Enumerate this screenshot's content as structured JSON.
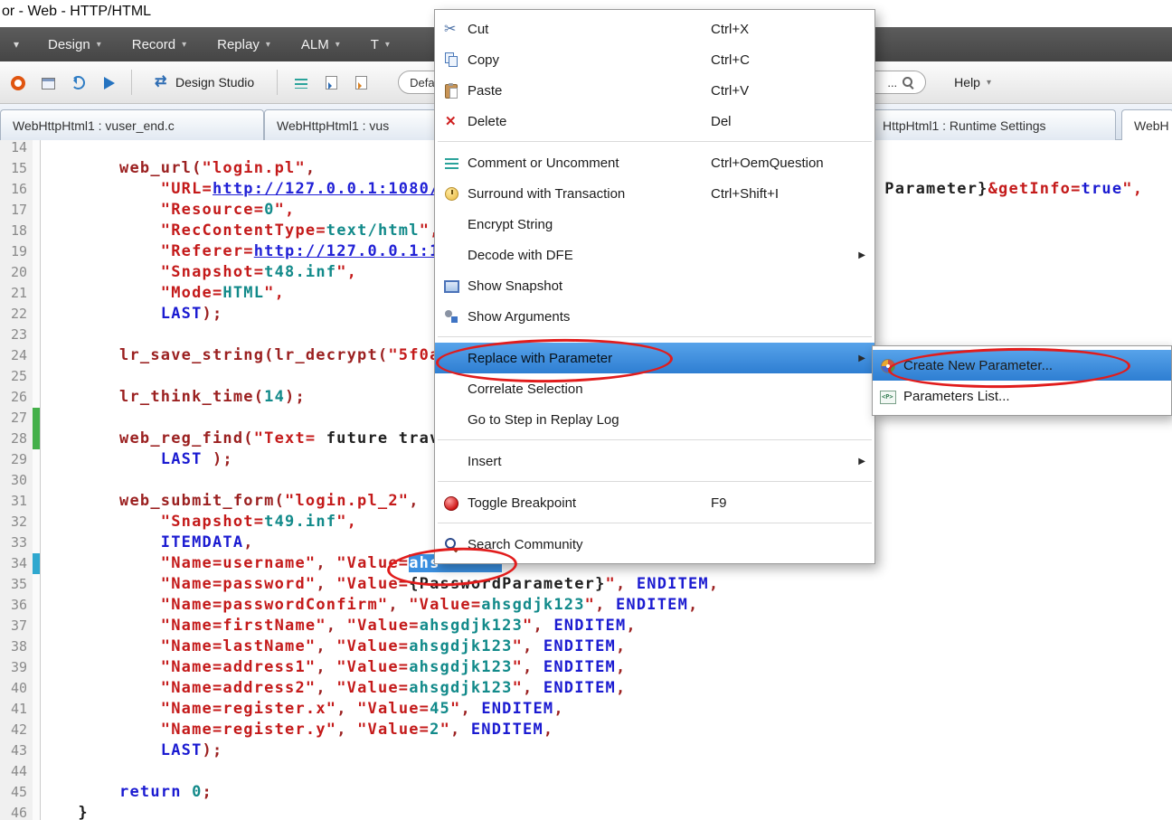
{
  "window": {
    "title": "or - Web - HTTP/HTML"
  },
  "icons": {
    "caret_down": "▾",
    "submenu_arrow": "▶"
  },
  "menubar": {
    "items": [
      {
        "label": "Design"
      },
      {
        "label": "Record"
      },
      {
        "label": "Replay"
      },
      {
        "label": "ALM"
      },
      {
        "label": "T"
      }
    ]
  },
  "toolbar": {
    "design_studio_label": "Design Studio",
    "profile_value": "Defaul",
    "search_text": "...",
    "help_label": "Help"
  },
  "tabs": [
    {
      "label": "WebHttpHtml1 : vuser_end.c",
      "active": false
    },
    {
      "label": "WebHttpHtml1 : vus",
      "active": false
    },
    {
      "label": "HttpHtml1 : Runtime Settings",
      "active": false
    },
    {
      "label": "WebH",
      "active": true
    }
  ],
  "context_menu": {
    "items": [
      {
        "type": "item",
        "icon": "cut-icon",
        "label": "Cut",
        "shortcut": "Ctrl+X"
      },
      {
        "type": "item",
        "icon": "copy-icon",
        "label": "Copy",
        "shortcut": "Ctrl+C"
      },
      {
        "type": "item",
        "icon": "paste-icon",
        "label": "Paste",
        "shortcut": "Ctrl+V"
      },
      {
        "type": "item",
        "icon": "delete-icon",
        "label": "Delete",
        "shortcut": "Del"
      },
      {
        "type": "separator"
      },
      {
        "type": "item",
        "icon": "comment-icon",
        "label": "Comment or Uncomment",
        "shortcut": "Ctrl+OemQuestion"
      },
      {
        "type": "item",
        "icon": "transaction-icon",
        "label": "Surround with Transaction",
        "shortcut": "Ctrl+Shift+I"
      },
      {
        "type": "item",
        "label": "Encrypt String"
      },
      {
        "type": "item",
        "label": "Decode with DFE",
        "submenu": true
      },
      {
        "type": "item",
        "icon": "snapshot-icon",
        "label": "Show Snapshot"
      },
      {
        "type": "item",
        "icon": "arguments-icon",
        "label": "Show Arguments"
      },
      {
        "type": "separator"
      },
      {
        "type": "item",
        "label": "Replace with Parameter",
        "submenu": true,
        "highlighted": true
      },
      {
        "type": "item",
        "label": "Correlate Selection"
      },
      {
        "type": "item",
        "label": "Go to Step in Replay Log"
      },
      {
        "type": "separator"
      },
      {
        "type": "item",
        "label": "Insert",
        "submenu": true
      },
      {
        "type": "separator"
      },
      {
        "type": "item",
        "icon": "breakpoint-icon",
        "label": "Toggle Breakpoint",
        "shortcut": "F9"
      },
      {
        "type": "separator"
      },
      {
        "type": "item",
        "icon": "search-community-icon",
        "label": "Search Community"
      }
    ]
  },
  "submenu": {
    "items": [
      {
        "icon": "new-parameter-icon",
        "label": "Create New Parameter...",
        "highlighted": true
      },
      {
        "icon": "parameters-list-icon",
        "label": "Parameters List..."
      }
    ]
  },
  "editor": {
    "lines": [
      {
        "no": "14",
        "segments": []
      },
      {
        "no": "15",
        "segments": [
          {
            "t": "       ",
            "c": "sp"
          },
          {
            "t": "web_url(",
            "c": "fn"
          },
          {
            "t": "\"login.pl\"",
            "c": "str"
          },
          {
            "t": ",",
            "c": "pun"
          }
        ]
      },
      {
        "no": "16",
        "segments": [
          {
            "t": "           ",
            "c": "sp"
          },
          {
            "t": "\"URL=",
            "c": "str"
          },
          {
            "t": "http://127.0.0.1:1080/",
            "c": "url"
          },
          {
            "t": "                                           ",
            "c": "sp"
          },
          {
            "t": "Parameter}",
            "c": "param"
          },
          {
            "t": "&getInfo=",
            "c": "str"
          },
          {
            "t": "true",
            "c": "kw"
          },
          {
            "t": "\",",
            "c": "str"
          }
        ]
      },
      {
        "no": "17",
        "segments": [
          {
            "t": "           ",
            "c": "sp"
          },
          {
            "t": "\"Resource=",
            "c": "str"
          },
          {
            "t": "0",
            "c": "val"
          },
          {
            "t": "\",",
            "c": "str"
          }
        ]
      },
      {
        "no": "18",
        "segments": [
          {
            "t": "           ",
            "c": "sp"
          },
          {
            "t": "\"RecContentType=",
            "c": "str"
          },
          {
            "t": "text/html",
            "c": "val"
          },
          {
            "t": "\",",
            "c": "str"
          }
        ]
      },
      {
        "no": "19",
        "segments": [
          {
            "t": "           ",
            "c": "sp"
          },
          {
            "t": "\"Referer=",
            "c": "str"
          },
          {
            "t": "http://127.0.0.1:1",
            "c": "url"
          }
        ]
      },
      {
        "no": "20",
        "segments": [
          {
            "t": "           ",
            "c": "sp"
          },
          {
            "t": "\"Snapshot=",
            "c": "str"
          },
          {
            "t": "t48.inf",
            "c": "val"
          },
          {
            "t": "\",",
            "c": "str"
          }
        ]
      },
      {
        "no": "21",
        "segments": [
          {
            "t": "           ",
            "c": "sp"
          },
          {
            "t": "\"Mode=",
            "c": "str"
          },
          {
            "t": "HTML",
            "c": "val"
          },
          {
            "t": "\",",
            "c": "str"
          }
        ]
      },
      {
        "no": "22",
        "segments": [
          {
            "t": "           ",
            "c": "sp"
          },
          {
            "t": "LAST",
            "c": "kw"
          },
          {
            "t": ");",
            "c": "pun"
          }
        ]
      },
      {
        "no": "23",
        "segments": []
      },
      {
        "no": "24",
        "segments": [
          {
            "t": "       ",
            "c": "sp"
          },
          {
            "t": "lr_save_string(lr_decrypt(",
            "c": "fn"
          },
          {
            "t": "\"5f0a",
            "c": "str"
          }
        ]
      },
      {
        "no": "25",
        "segments": []
      },
      {
        "no": "26",
        "segments": [
          {
            "t": "       ",
            "c": "sp"
          },
          {
            "t": "lr_think_time(",
            "c": "fn"
          },
          {
            "t": "14",
            "c": "val"
          },
          {
            "t": ");",
            "c": "pun"
          }
        ]
      },
      {
        "no": "27",
        "mark": "green",
        "segments": []
      },
      {
        "no": "28",
        "mark": "green",
        "segments": [
          {
            "t": "       ",
            "c": "sp"
          },
          {
            "t": "web_reg_find(",
            "c": "fn"
          },
          {
            "t": "\"Text=",
            "c": "str"
          },
          {
            "t": " future trav",
            "c": "param"
          }
        ]
      },
      {
        "no": "29",
        "segments": [
          {
            "t": "           ",
            "c": "sp"
          },
          {
            "t": "LAST",
            "c": "kw"
          },
          {
            "t": " );",
            "c": "pun"
          }
        ]
      },
      {
        "no": "30",
        "segments": []
      },
      {
        "no": "31",
        "segments": [
          {
            "t": "       ",
            "c": "sp"
          },
          {
            "t": "web_submit_form(",
            "c": "fn"
          },
          {
            "t": "\"login.pl_2\"",
            "c": "str"
          },
          {
            "t": ",",
            "c": "pun"
          }
        ]
      },
      {
        "no": "32",
        "segments": [
          {
            "t": "           ",
            "c": "sp"
          },
          {
            "t": "\"Snapshot=",
            "c": "str"
          },
          {
            "t": "t49.inf",
            "c": "val"
          },
          {
            "t": "\",",
            "c": "str"
          }
        ]
      },
      {
        "no": "33",
        "segments": [
          {
            "t": "           ",
            "c": "sp"
          },
          {
            "t": "ITEMDATA",
            "c": "kw"
          },
          {
            "t": ",",
            "c": "pun"
          }
        ]
      },
      {
        "no": "34",
        "mark": "blue",
        "segments": [
          {
            "t": "           ",
            "c": "sp"
          },
          {
            "t": "\"Name=username\"",
            "c": "str"
          },
          {
            "t": ", ",
            "c": "pun"
          },
          {
            "t": "\"Value=",
            "c": "str"
          },
          {
            "t": "ahs",
            "c": "sel"
          },
          {
            "t": "      ",
            "c": "sel"
          }
        ]
      },
      {
        "no": "35",
        "segments": [
          {
            "t": "           ",
            "c": "sp"
          },
          {
            "t": "\"Name=password\"",
            "c": "str"
          },
          {
            "t": ", ",
            "c": "pun"
          },
          {
            "t": "\"Value=",
            "c": "str"
          },
          {
            "t": "{PasswordParameter}",
            "c": "param"
          },
          {
            "t": "\"",
            "c": "str"
          },
          {
            "t": ", ",
            "c": "pun"
          },
          {
            "t": "ENDITEM",
            "c": "kw"
          },
          {
            "t": ",",
            "c": "pun"
          }
        ]
      },
      {
        "no": "36",
        "segments": [
          {
            "t": "           ",
            "c": "sp"
          },
          {
            "t": "\"Name=passwordConfirm\"",
            "c": "str"
          },
          {
            "t": ", ",
            "c": "pun"
          },
          {
            "t": "\"Value=",
            "c": "str"
          },
          {
            "t": "ahsgdjk123",
            "c": "val"
          },
          {
            "t": "\"",
            "c": "str"
          },
          {
            "t": ", ",
            "c": "pun"
          },
          {
            "t": "ENDITEM",
            "c": "kw"
          },
          {
            "t": ",",
            "c": "pun"
          }
        ]
      },
      {
        "no": "37",
        "segments": [
          {
            "t": "           ",
            "c": "sp"
          },
          {
            "t": "\"Name=firstName\"",
            "c": "str"
          },
          {
            "t": ", ",
            "c": "pun"
          },
          {
            "t": "\"Value=",
            "c": "str"
          },
          {
            "t": "ahsgdjk123",
            "c": "val"
          },
          {
            "t": "\"",
            "c": "str"
          },
          {
            "t": ", ",
            "c": "pun"
          },
          {
            "t": "ENDITEM",
            "c": "kw"
          },
          {
            "t": ",",
            "c": "pun"
          }
        ]
      },
      {
        "no": "38",
        "segments": [
          {
            "t": "           ",
            "c": "sp"
          },
          {
            "t": "\"Name=lastName\"",
            "c": "str"
          },
          {
            "t": ", ",
            "c": "pun"
          },
          {
            "t": "\"Value=",
            "c": "str"
          },
          {
            "t": "ahsgdjk123",
            "c": "val"
          },
          {
            "t": "\"",
            "c": "str"
          },
          {
            "t": ", ",
            "c": "pun"
          },
          {
            "t": "ENDITEM",
            "c": "kw"
          },
          {
            "t": ",",
            "c": "pun"
          }
        ]
      },
      {
        "no": "39",
        "segments": [
          {
            "t": "           ",
            "c": "sp"
          },
          {
            "t": "\"Name=address1\"",
            "c": "str"
          },
          {
            "t": ", ",
            "c": "pun"
          },
          {
            "t": "\"Value=",
            "c": "str"
          },
          {
            "t": "ahsgdjk123",
            "c": "val"
          },
          {
            "t": "\"",
            "c": "str"
          },
          {
            "t": ", ",
            "c": "pun"
          },
          {
            "t": "ENDITEM",
            "c": "kw"
          },
          {
            "t": ",",
            "c": "pun"
          }
        ]
      },
      {
        "no": "40",
        "segments": [
          {
            "t": "           ",
            "c": "sp"
          },
          {
            "t": "\"Name=address2\"",
            "c": "str"
          },
          {
            "t": ", ",
            "c": "pun"
          },
          {
            "t": "\"Value=",
            "c": "str"
          },
          {
            "t": "ahsgdjk123",
            "c": "val"
          },
          {
            "t": "\"",
            "c": "str"
          },
          {
            "t": ", ",
            "c": "pun"
          },
          {
            "t": "ENDITEM",
            "c": "kw"
          },
          {
            "t": ",",
            "c": "pun"
          }
        ]
      },
      {
        "no": "41",
        "segments": [
          {
            "t": "           ",
            "c": "sp"
          },
          {
            "t": "\"Name=register.x\"",
            "c": "str"
          },
          {
            "t": ", ",
            "c": "pun"
          },
          {
            "t": "\"Value=",
            "c": "str"
          },
          {
            "t": "45",
            "c": "val"
          },
          {
            "t": "\"",
            "c": "str"
          },
          {
            "t": ", ",
            "c": "pun"
          },
          {
            "t": "ENDITEM",
            "c": "kw"
          },
          {
            "t": ",",
            "c": "pun"
          }
        ]
      },
      {
        "no": "42",
        "segments": [
          {
            "t": "           ",
            "c": "sp"
          },
          {
            "t": "\"Name=register.y\"",
            "c": "str"
          },
          {
            "t": ", ",
            "c": "pun"
          },
          {
            "t": "\"Value=",
            "c": "str"
          },
          {
            "t": "2",
            "c": "val"
          },
          {
            "t": "\"",
            "c": "str"
          },
          {
            "t": ", ",
            "c": "pun"
          },
          {
            "t": "ENDITEM",
            "c": "kw"
          },
          {
            "t": ",",
            "c": "pun"
          }
        ]
      },
      {
        "no": "43",
        "segments": [
          {
            "t": "           ",
            "c": "sp"
          },
          {
            "t": "LAST",
            "c": "kw"
          },
          {
            "t": ");",
            "c": "pun"
          }
        ]
      },
      {
        "no": "44",
        "segments": []
      },
      {
        "no": "45",
        "segments": [
          {
            "t": "       ",
            "c": "sp"
          },
          {
            "t": "return",
            "c": "kw"
          },
          {
            "t": " ",
            "c": "sp"
          },
          {
            "t": "0",
            "c": "val"
          },
          {
            "t": ";",
            "c": "pun"
          }
        ]
      },
      {
        "no": "46",
        "segments": [
          {
            "t": "   ",
            "c": "sp"
          },
          {
            "t": "}",
            "c": "plain"
          }
        ]
      }
    ]
  },
  "annotations": {
    "color": "#e11c1c"
  }
}
